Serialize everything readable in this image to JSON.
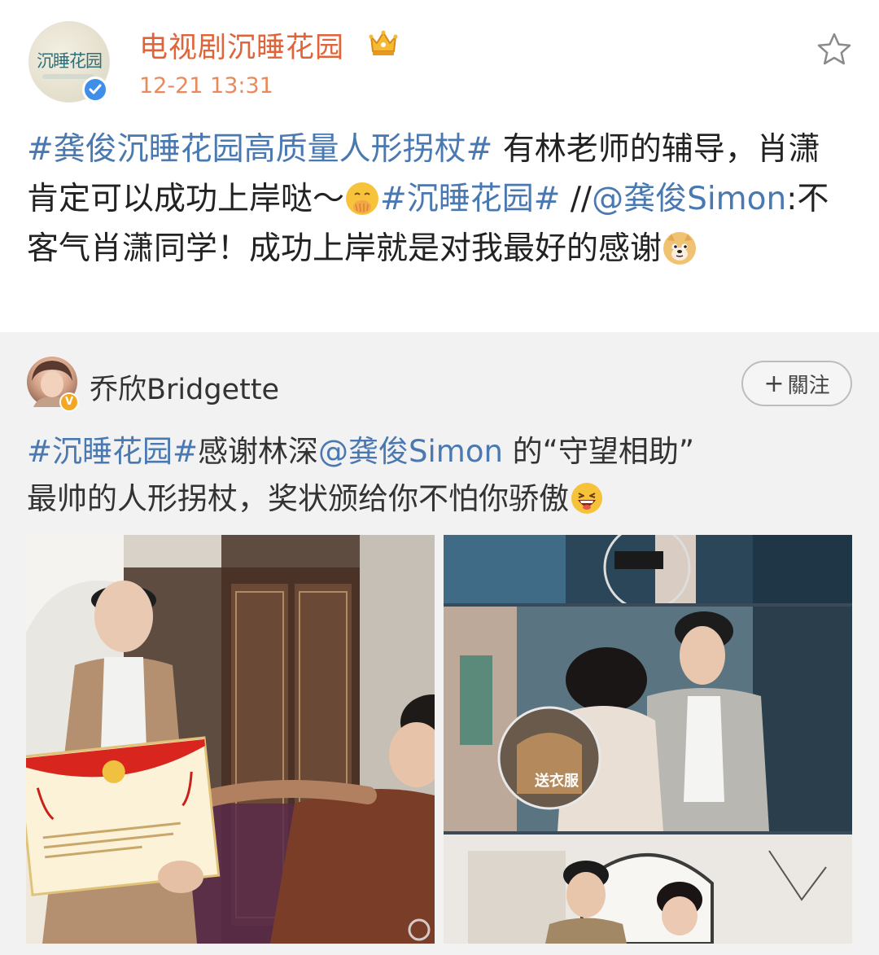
{
  "post": {
    "author": {
      "name": "电视剧沉睡花园",
      "avatar_text": "沉睡花园",
      "verified_icon": "verified-badge-icon",
      "member_icon": "vip-crown-icon"
    },
    "timestamp": "12-21 13:31",
    "favorite_icon": "star-outline-icon",
    "text": {
      "tag1": "#龚俊沉睡花园高质量人形拐杖#",
      "seg1": " 有林老师的辅导，肖潇肯定可以成功上岸哒～",
      "tag2": "#沉睡花园#",
      "seg2": " //",
      "mention": "@龚俊Simon",
      "seg3": ":不客气肖潇同学！成功上岸就是对我最好的感谢",
      "emoji1": "cover-face-emoji",
      "emoji2": "doge-emoji"
    }
  },
  "repost": {
    "author": {
      "name": "乔欣Bridgette",
      "verified_icon": "yellow-v-badge-icon"
    },
    "follow_label": "關注",
    "text": {
      "tag": "#沉睡花园#",
      "seg1": "感谢林深",
      "mention": "@龚俊Simon",
      "seg2": " 的“守望相助”",
      "seg3": "最帅的人形拐杖，奖状颁给你不怕你骄傲",
      "emoji": "laughing-emoji"
    },
    "images": [
      {
        "name": "award-certificate-photo"
      },
      {
        "name": "collage-photo",
        "magnifier_caption": "送衣服"
      }
    ]
  },
  "colors": {
    "username": "#e0643a",
    "timestamp": "#e88a5c",
    "link": "#4a78b0",
    "repost_bg": "#f2f2f2"
  }
}
